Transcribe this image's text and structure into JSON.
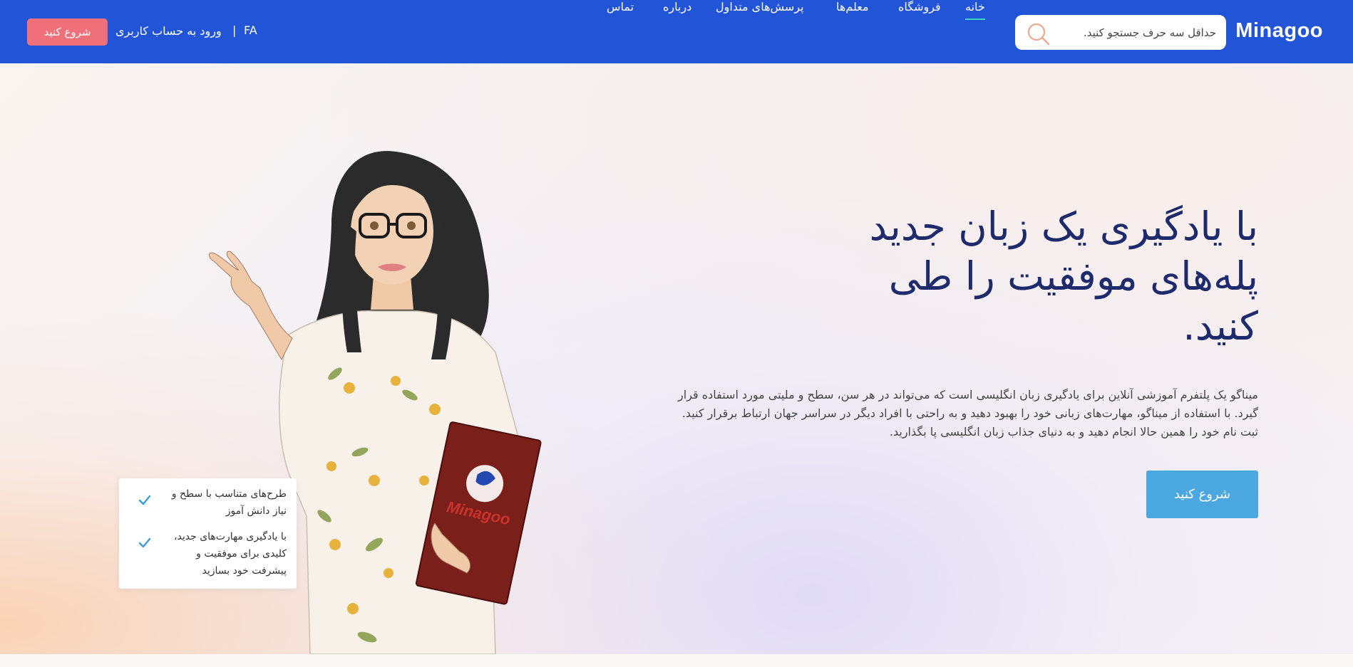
{
  "header": {
    "brand": "Minagoo",
    "search": {
      "placeholder": "حداقل سه حرف جستجو کنید."
    },
    "nav": [
      {
        "label": "خانه",
        "active": true
      },
      {
        "label": "فروشگاه"
      },
      {
        "label": "معلم‌ها"
      },
      {
        "label": "پرسش‌های متداول"
      },
      {
        "label": "درباره"
      },
      {
        "label": "تماس"
      }
    ],
    "language": "FA",
    "separator": "|",
    "login_label": "ورود به حساب کاربری",
    "cta_label": "شروع کنید",
    "colors": {
      "navbar": "#2154d6",
      "cta": "#f0707a",
      "active_underline": "#3cd2c5"
    }
  },
  "hero": {
    "headline": "با یادگیری یک زبان جدید پله‌های موفقیت را طی کنید.",
    "description": "میناگو یک پلتفرم آموزشی آنلاین برای یادگیری زبان انگلیسی است که می‌تواند در هر سن، سطح و ملیتی مورد استفاده قرار گیرد. با استفاده از میناگو، مهارت‌های زبانی خود را بهبود دهید و به راحتی با افراد دیگر در سراسر جهان ارتباط برقرار کنید. ثبت نام خود را همین حالا انجام دهید و به دنیای جذاب زبان انگلیسی پا بگذارید.",
    "cta_label": "شروع کنید",
    "book_logo_text": "Minagoo",
    "features": [
      "طرح‌های متناسب با سطح و نیاز دانش آموز",
      "با یادگیری مهارت‌های جدید، کلیدی برای موفقیت و پیشرفت خود بسازید"
    ],
    "colors": {
      "headline": "#1d2a6b",
      "cta": "#4ba7df",
      "check": "#3d9be0"
    }
  },
  "icons": {
    "search": "search-icon",
    "check": "check-icon"
  }
}
